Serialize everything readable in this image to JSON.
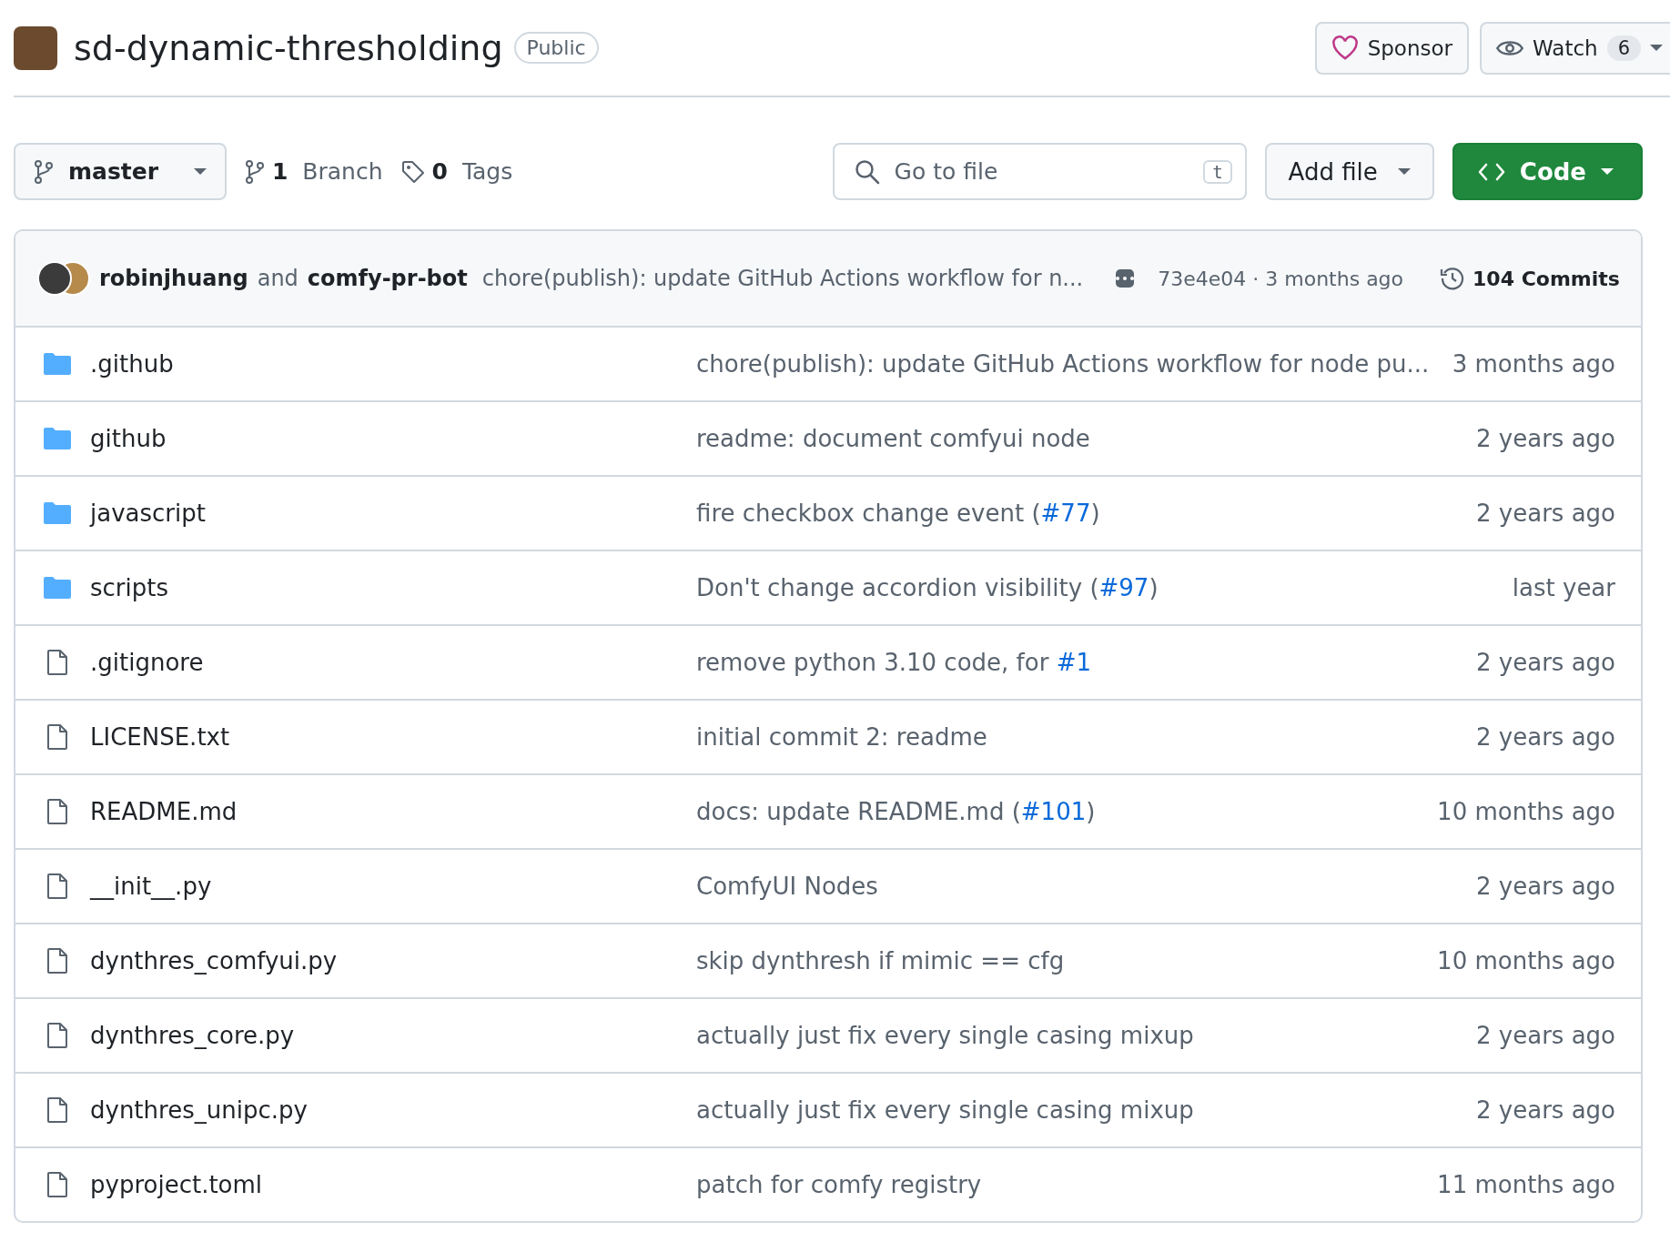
{
  "repo": {
    "name": "sd-dynamic-thresholding",
    "visibility": "Public"
  },
  "actions": {
    "sponsor": "Sponsor",
    "watch": "Watch",
    "watch_count": "6"
  },
  "toolbar": {
    "branch": "master",
    "branches_count": "1",
    "branches_label": "Branch",
    "tags_count": "0",
    "tags_label": "Tags",
    "search": {
      "placeholder": "Go to file",
      "shortcut": "t"
    },
    "add_file": "Add file",
    "code": "Code"
  },
  "latest_commit": {
    "authors": [
      "robinjhuang",
      "comfy-pr-bot"
    ],
    "joiner": "and",
    "message": "chore(publish): update GitHub Actions workflow for n...",
    "sha": "73e4e04",
    "time": "3 months ago",
    "separator": "·",
    "commits_count": "104",
    "commits_label": "Commits"
  },
  "files": [
    {
      "kind": "folder",
      "name": ".github",
      "message": [
        {
          "kind": "text",
          "text": "chore(publish): update GitHub Actions workflow for node pu..."
        }
      ],
      "time": "3 months ago"
    },
    {
      "kind": "folder",
      "name": "github",
      "message": [
        {
          "kind": "text",
          "text": "readme: document comfyui node"
        }
      ],
      "time": "2 years ago"
    },
    {
      "kind": "folder",
      "name": "javascript",
      "message": [
        {
          "kind": "text",
          "text": "fire checkbox change event ("
        },
        {
          "kind": "link",
          "text": "#77"
        },
        {
          "kind": "text",
          "text": ")"
        }
      ],
      "time": "2 years ago"
    },
    {
      "kind": "folder",
      "name": "scripts",
      "message": [
        {
          "kind": "text",
          "text": "Don't change accordion visibility ("
        },
        {
          "kind": "link",
          "text": "#97"
        },
        {
          "kind": "text",
          "text": ")"
        }
      ],
      "time": "last year"
    },
    {
      "kind": "file",
      "name": ".gitignore",
      "message": [
        {
          "kind": "text",
          "text": "remove python 3.10 code, for "
        },
        {
          "kind": "link",
          "text": "#1"
        }
      ],
      "time": "2 years ago"
    },
    {
      "kind": "file",
      "name": "LICENSE.txt",
      "message": [
        {
          "kind": "text",
          "text": "initial commit 2: readme"
        }
      ],
      "time": "2 years ago"
    },
    {
      "kind": "file",
      "name": "README.md",
      "message": [
        {
          "kind": "text",
          "text": "docs: update README.md ("
        },
        {
          "kind": "link",
          "text": "#101"
        },
        {
          "kind": "text",
          "text": ")"
        }
      ],
      "time": "10 months ago"
    },
    {
      "kind": "file",
      "name": "__init__.py",
      "message": [
        {
          "kind": "text",
          "text": "ComfyUI Nodes"
        }
      ],
      "time": "2 years ago"
    },
    {
      "kind": "file",
      "name": "dynthres_comfyui.py",
      "message": [
        {
          "kind": "text",
          "text": "skip dynthresh if mimic == cfg"
        }
      ],
      "time": "10 months ago"
    },
    {
      "kind": "file",
      "name": "dynthres_core.py",
      "message": [
        {
          "kind": "text",
          "text": "actually just fix every single casing mixup"
        }
      ],
      "time": "2 years ago"
    },
    {
      "kind": "file",
      "name": "dynthres_unipc.py",
      "message": [
        {
          "kind": "text",
          "text": "actually just fix every single casing mixup"
        }
      ],
      "time": "2 years ago"
    },
    {
      "kind": "file",
      "name": "pyproject.toml",
      "message": [
        {
          "kind": "text",
          "text": "patch for comfy registry"
        }
      ],
      "time": "11 months ago"
    }
  ]
}
